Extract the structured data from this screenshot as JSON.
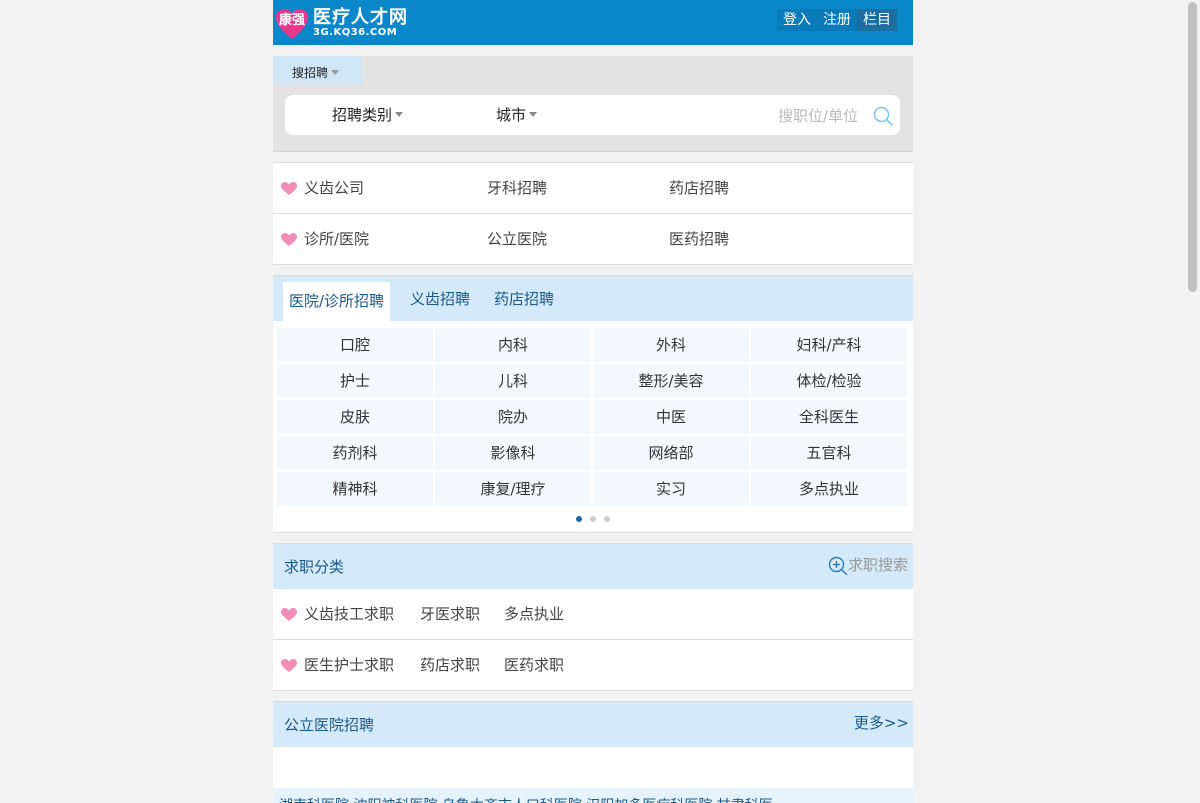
{
  "header": {
    "logo_tag": "康强",
    "logo_title": "医疗人才网",
    "logo_sub": "3G.KQ36.COM",
    "nav": [
      "登入",
      "注册",
      "栏目"
    ]
  },
  "search": {
    "tab_label": "搜招聘",
    "category_label": "招聘类别",
    "city_label": "城市",
    "placeholder": "搜职位/单位"
  },
  "quick_links": [
    [
      "义齿公司",
      "牙科招聘",
      "药店招聘"
    ],
    [
      "诊所/医院",
      "公立医院",
      "医药招聘"
    ]
  ],
  "tabs": {
    "labels": [
      "医院/诊所招聘",
      "义齿招聘",
      "药店招聘"
    ],
    "active": 0,
    "cells": [
      "口腔",
      "内科",
      "外科",
      "妇科/产科",
      "护士",
      "儿科",
      "整形/美容",
      "体检/检验",
      "皮肤",
      "院办",
      "中医",
      "全科医生",
      "药剂科",
      "影像科",
      "网络部",
      "五官科",
      "精神科",
      "康复/理疗",
      "实习",
      "多点执业"
    ],
    "page_count": 3,
    "page_active": 0
  },
  "job_seek": {
    "title": "求职分类",
    "search_label": "求职搜索",
    "rows": [
      [
        "义齿技工求职",
        "牙医求职",
        "多点执业"
      ],
      [
        "医生护士求职",
        "药店求职",
        "医药求职"
      ]
    ]
  },
  "public_hospital": {
    "title": "公立医院招聘",
    "more_label": "更多>>",
    "strip_text": "湖南科医院  沈阳神科医院  乌鲁木齐市人口科医院  汉阳加多医疗科医院  甘肃科医"
  },
  "colors": {
    "header_bg": "#0a87c9",
    "tab_bg": "#d4e9f9",
    "heart": "#f28db6",
    "link_blue": "#1b5b8a"
  }
}
